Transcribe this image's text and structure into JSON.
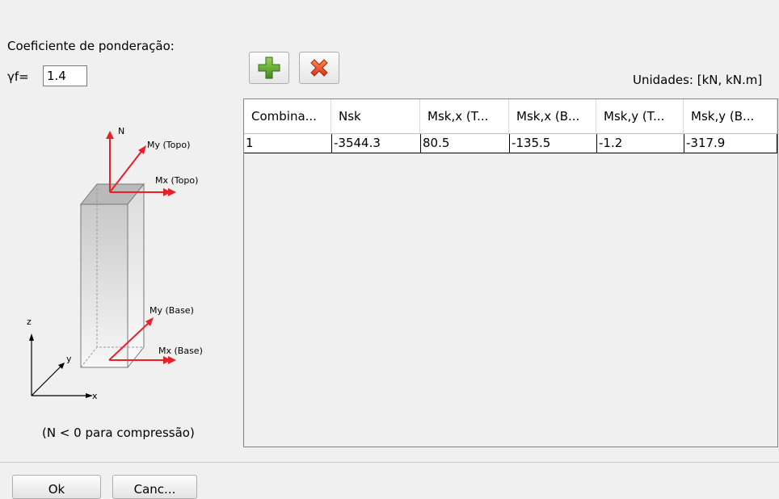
{
  "coef_label": "Coeficiente de ponderação:",
  "gamma": {
    "label": "γf=",
    "value": "1.4"
  },
  "toolbar": {
    "add_icon": "plus-icon",
    "delete_icon": "x-icon"
  },
  "units_label": "Unidades: [kN, kN.m]",
  "diagram": {
    "n_label": "N",
    "my_top": "My (Topo)",
    "mx_top": "Mx (Topo)",
    "my_base": "My (Base)",
    "mx_base": "Mx (Base)",
    "z": "z",
    "y": "y",
    "x": "x",
    "red": "#e8202a"
  },
  "note": "(N < 0 para compressão)",
  "table": {
    "columns": [
      "Combina...",
      "Nsk",
      "Msk,x (T...",
      "Msk,x (B...",
      "Msk,y (T...",
      "Msk,y (B..."
    ],
    "rows": [
      [
        "1",
        "-3544.3",
        "80.5",
        "-135.5",
        "-1.2",
        "-317.9"
      ]
    ]
  },
  "buttons": {
    "ok": "Ok",
    "cancel": "Canc..."
  }
}
